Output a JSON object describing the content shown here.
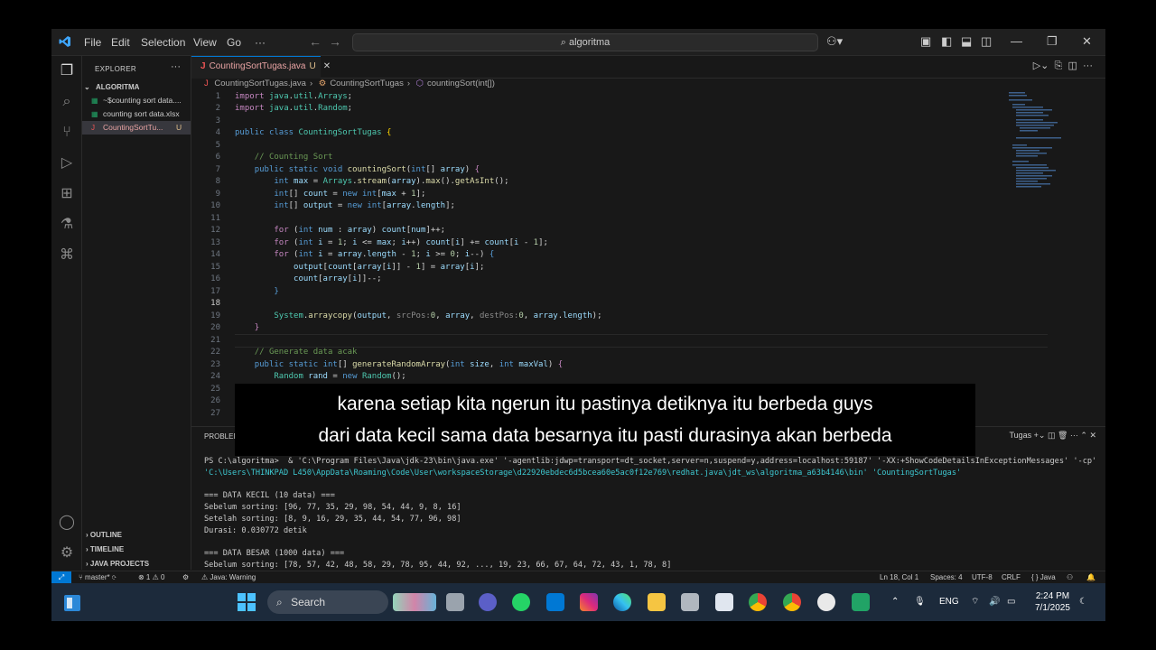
{
  "titlebar": {
    "menus": [
      "File",
      "Edit",
      "Selection",
      "View",
      "Go",
      "···"
    ],
    "search_text": "algoritma"
  },
  "explorer": {
    "title": "EXPLORER",
    "folder": "ALGORITMA",
    "files": [
      {
        "name": "~$counting sort data....",
        "icon": "excel-icon",
        "status": ""
      },
      {
        "name": "counting sort data.xlsx",
        "icon": "excel-icon",
        "status": ""
      },
      {
        "name": "CountingSortTu...",
        "icon": "java-icon",
        "status": "U"
      }
    ],
    "bottom_sections": [
      "OUTLINE",
      "TIMELINE",
      "JAVA PROJECTS"
    ]
  },
  "editor": {
    "tab_label": "CountingSortTugas.java",
    "tab_status": "U",
    "breadcrumb": [
      "CountingSortTugas.java",
      "CountingSortTugas",
      "countingSort(int[])"
    ],
    "current_line": 18
  },
  "panel": {
    "tab_label": "PROBLEM",
    "right_label": "Tugas",
    "terminal": {
      "line1": "PS C:\\algoritma>  & 'C:\\Program Files\\Java\\jdk-23\\bin\\java.exe' '-agentlib:jdwp=transport=dt_socket,server=n,suspend=y,address=localhost:59187' '-XX:+ShowCodeDetailsInExceptionMessages' '-cp'",
      "line2": "'C:\\Users\\THINKPAD L450\\AppData\\Roaming\\Code\\User\\workspaceStorage\\d22920ebdec6d5bcea60e5ac0f12e769\\redhat.java\\jdt_ws\\algoritma_a63b4146\\bin' 'CountingSortTugas'",
      "line3": "=== DATA KECIL (10 data) ===",
      "line4": "Sebelum sorting: [96, 77, 35, 29, 98, 54, 44, 9, 8, 16]",
      "line5": "Setelah sorting: [8, 9, 16, 29, 35, 44, 54, 77, 96, 98]",
      "line6": "Durasi: 0.030772 detik",
      "line7": "=== DATA BESAR (1000 data) ===",
      "line8": "Sebelum sorting: [78, 57, 42, 48, 58, 29, 78, 95, 44, 92, ..., 19, 23, 66, 67, 64, 72, 43, 1, 78, 8]"
    }
  },
  "statusbar": {
    "branch": "master*",
    "problems": "⊗ 1 ⚠ 0",
    "java_status": "Java: Warning",
    "position": "Ln 18, Col 1",
    "spaces": "Spaces: 4",
    "encoding": "UTF-8",
    "eol": "CRLF",
    "language": "Java"
  },
  "taskbar": {
    "search_label": "Search",
    "language": "ENG",
    "time": "2:24 PM",
    "date": "7/1/2025"
  },
  "subtitle": {
    "line1": "karena setiap kita ngerun itu pastinya detiknya itu berbeda guys",
    "line2": "dari data kecil sama data besarnya itu pasti durasinya akan berbeda"
  },
  "colors": {
    "accent": "#0078d4",
    "editor_bg": "#1f1f1f",
    "taskbar_bg": "#1c2a3b"
  }
}
